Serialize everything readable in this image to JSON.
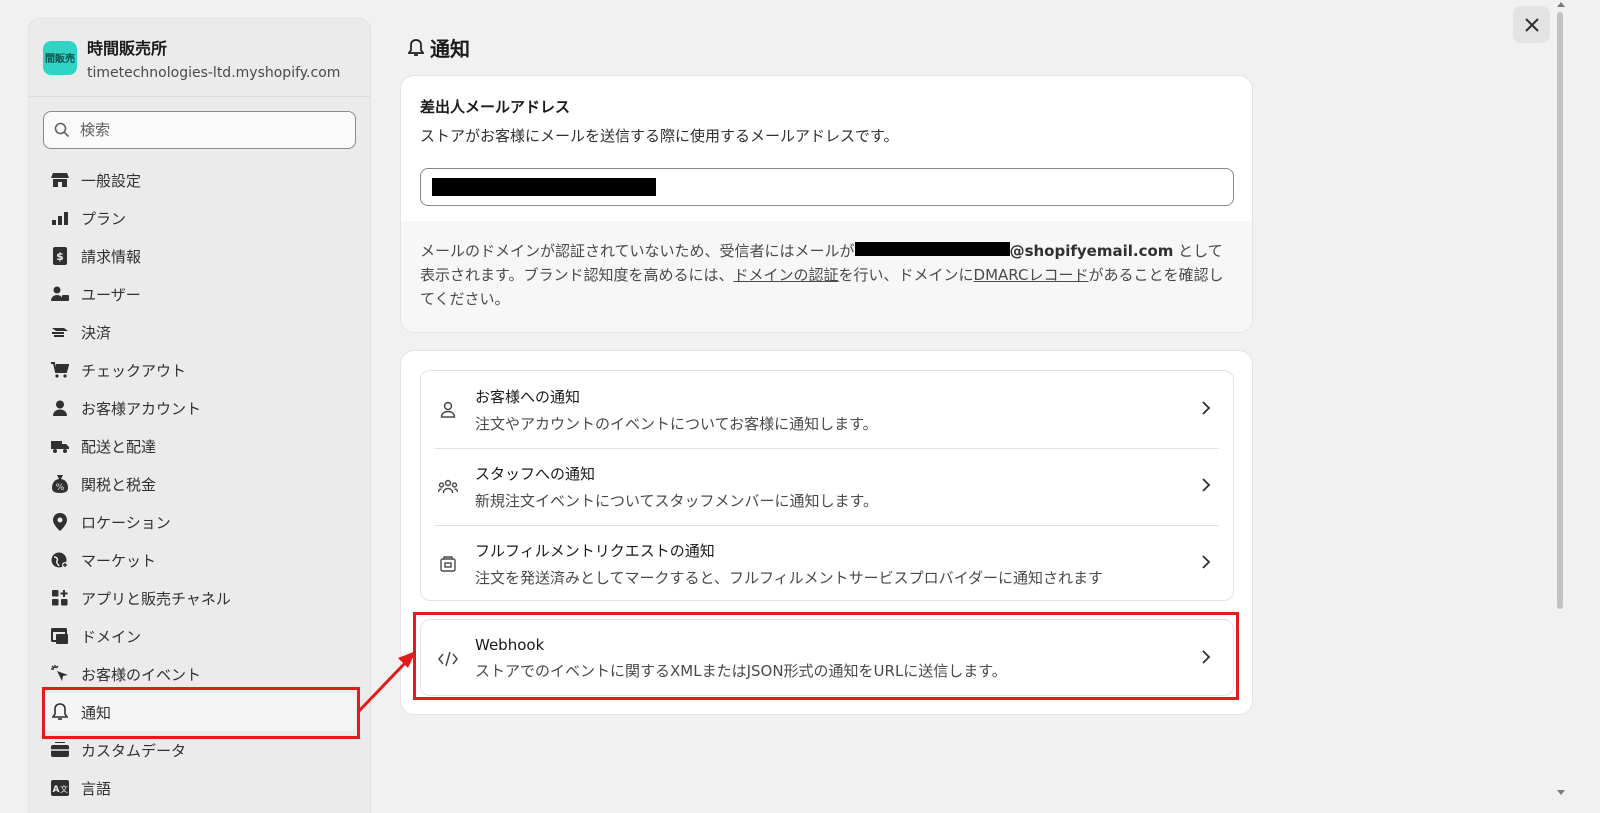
{
  "store": {
    "logo_text": "間販売",
    "name": "時間販売所",
    "domain": "timetechnologies-ltd.myshopify.com"
  },
  "search": {
    "placeholder": "検索"
  },
  "nav": {
    "items": [
      {
        "label": "一般設定",
        "icon": "store-icon"
      },
      {
        "label": "プラン",
        "icon": "plan-icon"
      },
      {
        "label": "請求情報",
        "icon": "billing-icon"
      },
      {
        "label": "ユーザー",
        "icon": "users-icon"
      },
      {
        "label": "決済",
        "icon": "payments-icon"
      },
      {
        "label": "チェックアウト",
        "icon": "cart-icon"
      },
      {
        "label": "お客様アカウント",
        "icon": "person-icon"
      },
      {
        "label": "配送と配達",
        "icon": "truck-icon"
      },
      {
        "label": "関税と税金",
        "icon": "tax-icon"
      },
      {
        "label": "ロケーション",
        "icon": "location-pin-icon"
      },
      {
        "label": "マーケット",
        "icon": "globe-icon"
      },
      {
        "label": "アプリと販売チャネル",
        "icon": "apps-icon"
      },
      {
        "label": "ドメイン",
        "icon": "domain-icon"
      },
      {
        "label": "お客様のイベント",
        "icon": "cursor-icon"
      },
      {
        "label": "通知",
        "icon": "bell-icon",
        "active": true
      },
      {
        "label": "カスタムデータ",
        "icon": "custom-data-icon"
      },
      {
        "label": "言語",
        "icon": "language-icon"
      }
    ]
  },
  "main": {
    "title": "通知",
    "sender": {
      "label": "差出人メールアドレス",
      "desc": "ストアがお客様にメールを送信する際に使用するメールアドレスです。",
      "notice_p1": "メールのドメインが認証されていないため、受信者にはメールが",
      "notice_email_suffix": "@shopifyemail.com",
      "notice_p2": " として表示されます。ブランド認知度を高めるには、",
      "notice_link1": "ドメインの認証",
      "notice_p3": "を行い、ドメインに",
      "notice_link2": "DMARCレコード",
      "notice_p4": "があることを確認してください。"
    },
    "rows": [
      {
        "title": "お客様への通知",
        "desc": "注文やアカウントのイベントについてお客様に通知します。",
        "icon": "person-outline-icon"
      },
      {
        "title": "スタッフへの通知",
        "desc": "新規注文イベントについてスタッフメンバーに通知します。",
        "icon": "team-icon"
      },
      {
        "title": "フルフィルメントリクエストの通知",
        "desc": "注文を発送済みとしてマークすると、フルフィルメントサービスプロバイダーに通知されます",
        "icon": "fulfillment-icon"
      }
    ],
    "webhook": {
      "title": "Webhook",
      "desc": "ストアでのイベントに関するXMLまたはJSON形式の通知をURLに送信します。",
      "icon": "code-icon"
    }
  },
  "colors": {
    "highlight": "#e01c1c",
    "accent_logo": "#2fd4c4"
  }
}
